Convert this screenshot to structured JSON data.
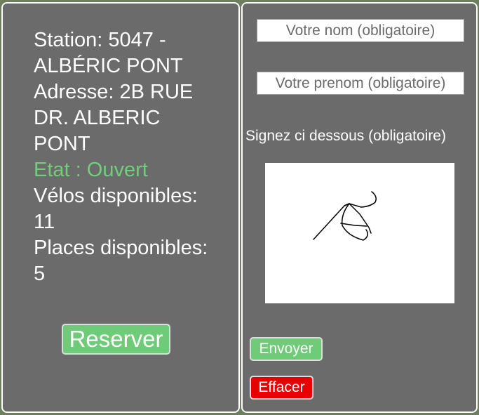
{
  "station": {
    "lines": [
      "Station: 5047 -",
      "ALBÉRIC PONT",
      "Adresse: 2B RUE",
      "DR. ALBERIC",
      "PONT"
    ],
    "status": "Etat : Ouvert",
    "bikes_label": "Vélos disponibles:",
    "bikes_value": "11",
    "places_label": "Places disponibles:",
    "places_value": "5"
  },
  "reserve_button": "Reserver",
  "form": {
    "nom_placeholder": "Votre nom (obligatoire)",
    "prenom_placeholder": "Votre prenom (obligatoire)",
    "signature_label": "Signez ci dessous (obligatoire)",
    "send_button": "Envoyer",
    "clear_button": "Effacer"
  },
  "colors": {
    "panel": "#6b6b6b",
    "open_status": "#6fcf7b",
    "green_button": "#6ecb77",
    "red_button": "#e60000"
  }
}
